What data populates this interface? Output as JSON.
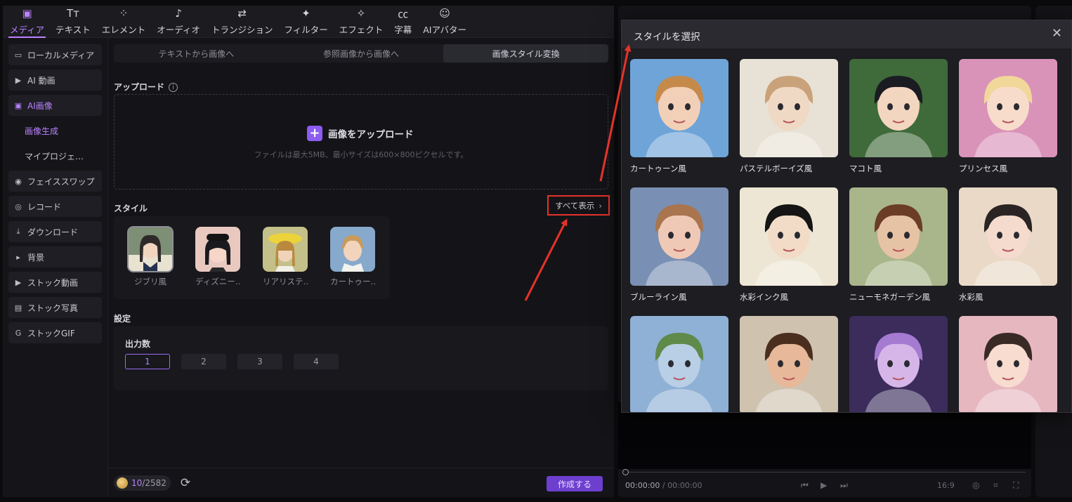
{
  "topnav": [
    {
      "label": "メディア",
      "icon": "media-icon",
      "active": true
    },
    {
      "label": "テキスト",
      "icon": "text-icon",
      "active": false
    },
    {
      "label": "エレメント",
      "icon": "elements-icon",
      "active": false
    },
    {
      "label": "オーディオ",
      "icon": "audio-icon",
      "active": false
    },
    {
      "label": "トランジション",
      "icon": "transition-icon",
      "active": false
    },
    {
      "label": "フィルター",
      "icon": "filter-icon",
      "active": false
    },
    {
      "label": "エフェクト",
      "icon": "effect-icon",
      "active": false
    },
    {
      "label": "字幕",
      "icon": "caption-icon",
      "active": false
    },
    {
      "label": "AIアバター",
      "icon": "ai-avatar-icon",
      "active": false
    }
  ],
  "sidebar": {
    "items": [
      {
        "label": "ローカルメディア",
        "icon": "folder-icon"
      },
      {
        "label": "AI 動画",
        "icon": "ai-video-icon"
      },
      {
        "label": "AI画像",
        "icon": "ai-image-icon",
        "active": true
      },
      {
        "label": "画像生成",
        "sub": true,
        "active": true
      },
      {
        "label": "マイプロジェ…",
        "sub": true
      },
      {
        "label": "フェイススワップ",
        "icon": "face-swap-icon"
      },
      {
        "label": "レコード",
        "icon": "record-icon"
      },
      {
        "label": "ダウンロード",
        "icon": "download-icon"
      },
      {
        "label": "背景",
        "icon": "triangle-right-icon"
      },
      {
        "label": "ストック動画",
        "icon": "stock-video-icon"
      },
      {
        "label": "ストック写真",
        "icon": "stock-photo-icon"
      },
      {
        "label": "ストックGIF",
        "icon": "gif-icon"
      }
    ]
  },
  "main": {
    "tabs": [
      {
        "label": "テキストから画像へ",
        "active": false
      },
      {
        "label": "参照画像から画像へ",
        "active": false
      },
      {
        "label": "画像スタイル変換",
        "active": true
      }
    ],
    "upload": {
      "section_label": "アップロード",
      "button_label": "画像をアップロード",
      "hint": "ファイルは最大5MB、最小サイズは600×800ピクセルです。"
    },
    "style": {
      "section_label": "スタイル",
      "show_all_label": "すべて表示",
      "cards": [
        {
          "name": "ジブリ風",
          "selected": true
        },
        {
          "name": "ディズニー…"
        },
        {
          "name": "リアリステ…"
        },
        {
          "name": "カートゥー…"
        }
      ]
    },
    "settings": {
      "section_label": "設定",
      "output_label": "出力数",
      "counts": [
        "1",
        "2",
        "3",
        "4"
      ],
      "selected_count": "1"
    }
  },
  "footer": {
    "credits_used": "10",
    "credits_total": "/2582",
    "create_label": "作成する"
  },
  "preview": {
    "current_time": "00:00:00",
    "separator": "/",
    "total_time": "00:00:00",
    "ratio": "16:9"
  },
  "modal": {
    "title": "スタイルを選択",
    "styles": [
      {
        "name": "カートゥーン風",
        "bg": "#6fa4d8",
        "skin": "#f2d0b8",
        "hair": "#c58a4a"
      },
      {
        "name": "パステルボーイズ風",
        "bg": "#e8e2d6",
        "skin": "#f0d9c4",
        "hair": "#c9a27a"
      },
      {
        "name": "マコト風",
        "bg": "#3f6a3a",
        "skin": "#f3d6c0",
        "hair": "#1b1b22"
      },
      {
        "name": "プリンセス風",
        "bg": "#d993b8",
        "skin": "#f7dccb",
        "hair": "#f2d79a"
      },
      {
        "name": "ブルーライン風",
        "bg": "#7a8fb4",
        "skin": "#f0c9b6",
        "hair": "#a8754e"
      },
      {
        "name": "水彩インク風",
        "bg": "#eee6d4",
        "skin": "#f2dcc8",
        "hair": "#151515"
      },
      {
        "name": "ニューモネガーデン風",
        "bg": "#a9b58a",
        "skin": "#e7c3a5",
        "hair": "#6b3d26"
      },
      {
        "name": "水彩風",
        "bg": "#e9d9c6",
        "skin": "#f5dbcd",
        "hair": "#2b2424"
      },
      {
        "name": "",
        "bg": "#8fb1d6",
        "skin": "#b9cfe6",
        "hair": "#5f8a4a"
      },
      {
        "name": "",
        "bg": "#cfc3b0",
        "skin": "#e7b89a",
        "hair": "#4a2f1e"
      },
      {
        "name": "",
        "bg": "#3b2c5c",
        "skin": "#d6b6e8",
        "hair": "#a57ad1"
      },
      {
        "name": "",
        "bg": "#e7b7c0",
        "skin": "#f7dccf",
        "hair": "#3a2a26"
      }
    ]
  },
  "colors": {
    "accent": "#b982ff",
    "highlight_red": "#e5332a",
    "create_button": "#6d3fcf"
  }
}
